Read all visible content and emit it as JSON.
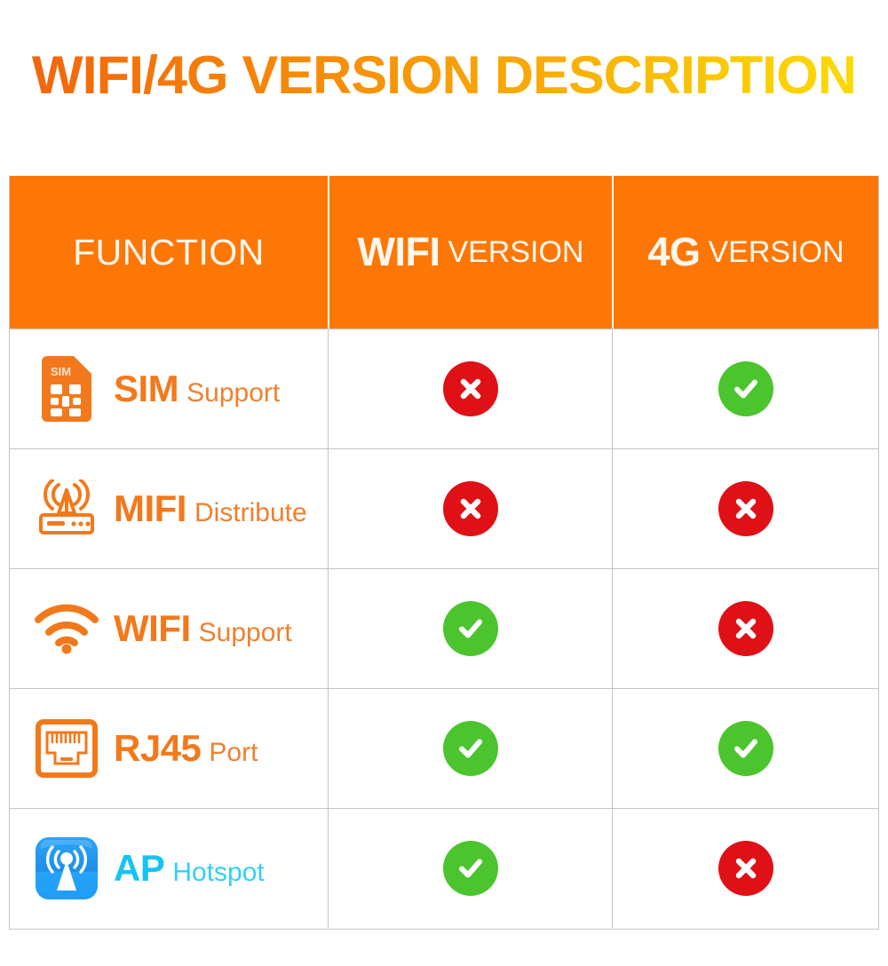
{
  "page": {
    "title": "WIFI/4G VERSION DESCRIPTION",
    "title_gradient_from": "#F2650C",
    "title_gradient_to": "#FCD905",
    "background": "#FFFFFF"
  },
  "colors": {
    "header_orange": "#FD7706",
    "text_orange": "#F2791B",
    "text_orange_light": "#EE8030",
    "ap_cyan": "#17C3F3",
    "yes_green": "#4BC42E",
    "no_red": "#E01017",
    "border_gray": "#C4C4C4",
    "header_text": "#FFF7EE"
  },
  "table": {
    "headers": [
      {
        "id": "function",
        "strong": "FUNCTION",
        "light": ""
      },
      {
        "id": "wifi_version",
        "strong": "WIFI",
        "light": "VERSION"
      },
      {
        "id": "4g_version",
        "strong": "4G",
        "light": "VERSION"
      }
    ],
    "rows": [
      {
        "id": "sim",
        "icon": "sim-card-icon",
        "icon_text": "SIM",
        "label_strong": "SIM",
        "label_light": "Support",
        "wifi": "no",
        "fourg": "yes"
      },
      {
        "id": "mifi",
        "icon": "mifi-router-icon",
        "icon_text": "",
        "label_strong": "MIFI",
        "label_light": "Distribute",
        "wifi": "no",
        "fourg": "no"
      },
      {
        "id": "wifi",
        "icon": "wifi-signal-icon",
        "icon_text": "",
        "label_strong": "WIFI",
        "label_light": "Support",
        "wifi": "yes",
        "fourg": "no"
      },
      {
        "id": "rj45",
        "icon": "rj45-port-icon",
        "icon_text": "",
        "label_strong": "RJ45",
        "label_light": "Port",
        "wifi": "yes",
        "fourg": "yes"
      },
      {
        "id": "ap",
        "icon": "ap-hotspot-icon",
        "icon_text": "",
        "label_strong": "AP",
        "label_light": "Hotspot",
        "wifi": "yes",
        "fourg": "no"
      }
    ],
    "mark_labels": {
      "yes": "Supported",
      "no": "Not supported"
    }
  }
}
